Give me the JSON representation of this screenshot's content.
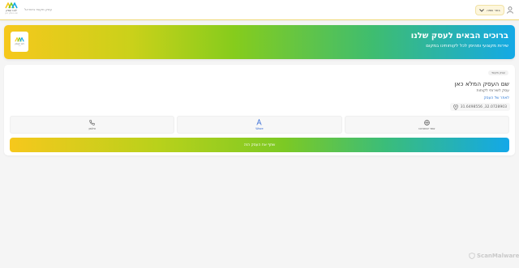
{
  "header": {
    "logo_name": "לוגו עסק",
    "logo_sub": "שם העסק כאן",
    "subtitle": "עסק מקומי בישראל",
    "lang_label": "בחר שפה",
    "lang_icon": "chevron-down-icon",
    "user_icon": "user-icon"
  },
  "banner": {
    "title": "ברוכים הבאים לעסק שלנו",
    "subtitle": "שירות מקצועי ומהימן לכל לקוחותינו במקום",
    "logo_name": "לוגו העסק",
    "logo_sub": "לוגו"
  },
  "business": {
    "tag": "עסק מקומי",
    "name": "שם העסק המלא כאן",
    "category": "עסק לשירותי לקוחות",
    "link": "לאתר של העסק",
    "coordinates": "31.6498556 ,32.0728903",
    "pin_icon": "location-pin-icon"
  },
  "actions": [
    {
      "label": "טלפון",
      "icon": "phone-icon"
    },
    {
      "label": "Waze",
      "icon": "navigation-icon"
    },
    {
      "label": "אתר אינטרנט",
      "icon": "globe-icon"
    }
  ],
  "cta": {
    "label": "שתף את העסק הזה"
  },
  "watermark": {
    "text": "ScanMalware"
  },
  "colors": {
    "brand_yellow": "#f6c81c",
    "brand_green": "#86cc1c",
    "brand_blue": "#14a9e6",
    "link_blue": "#2b78d6"
  }
}
